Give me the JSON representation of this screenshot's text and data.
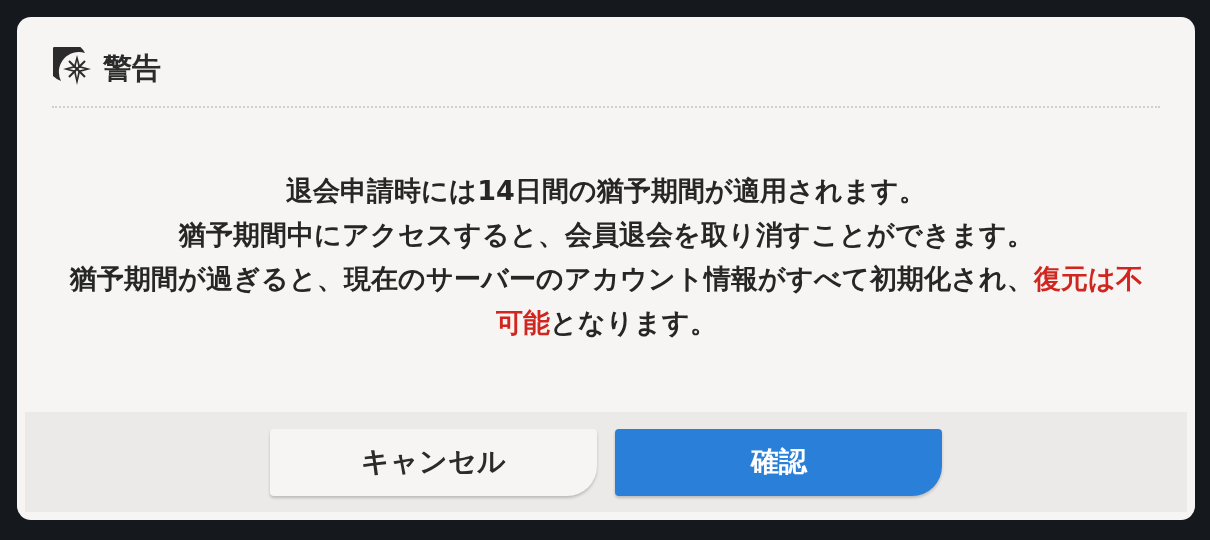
{
  "dialog": {
    "title": "警告",
    "message": [
      {
        "parts": [
          {
            "text": "退会申請時には14日間の猶予期間が適用されます。",
            "kind": "normal"
          }
        ]
      },
      {
        "parts": [
          {
            "text": "猶予期間中にアクセスすると、会員退会を取り消すことができます。",
            "kind": "normal"
          }
        ]
      },
      {
        "parts": [
          {
            "text": "猶予期間が過ぎると、現在のサーバーのアカウント情報がすべて初期化され、",
            "kind": "normal"
          },
          {
            "text": "復元は不可能",
            "kind": "alert"
          },
          {
            "text": "となります。",
            "kind": "normal"
          }
        ]
      }
    ],
    "buttons": [
      {
        "label": "キャンセル",
        "kind": "secondary"
      },
      {
        "label": "確認",
        "kind": "primary"
      }
    ]
  }
}
